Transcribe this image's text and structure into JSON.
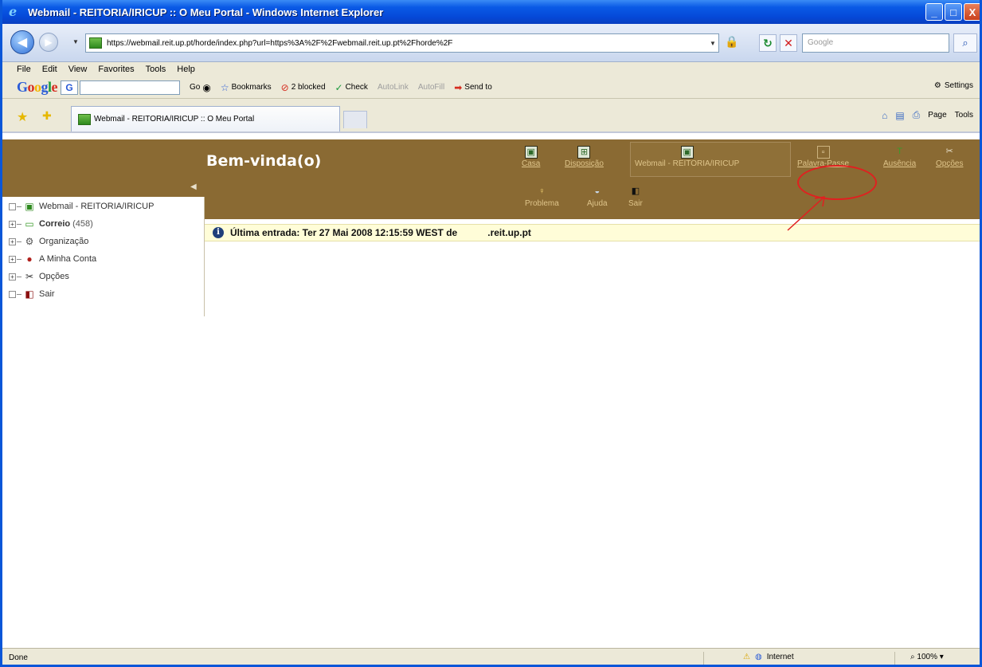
{
  "window": {
    "title": "Webmail - REITORIA/IRICUP :: O Meu Portal - Windows Internet Explorer",
    "buttons": {
      "minimize": "_",
      "maximize": "□",
      "close": "X"
    }
  },
  "address": {
    "url": "https://webmail.reit.up.pt/horde/index.php?url=https%3A%2F%2Fwebmail.reit.up.pt%2Fhorde%2F",
    "search_placeholder": "Google"
  },
  "menu": [
    "File",
    "Edit",
    "View",
    "Favorites",
    "Tools",
    "Help"
  ],
  "google_toolbar": {
    "go": "Go",
    "bookmarks": "Bookmarks",
    "blocked": "2 blocked",
    "check": "Check",
    "autolink": "AutoLink",
    "autofill": "AutoFill",
    "send_to": "Send to",
    "settings": "Settings"
  },
  "tabs": {
    "active_label": "Webmail - REITORIA/IRICUP :: O Meu Portal",
    "page_tool": "Page",
    "tools_tool": "Tools"
  },
  "portal": {
    "welcome": "Bem-vinda(o)",
    "nav": {
      "casa": "Casa",
      "disposicao": "Disposição",
      "webmail": "Webmail - REITORIA/IRICUP",
      "palavra_passe": "Palavra-Passe",
      "ausencia": "Ausência",
      "opcoes": "Opções",
      "problema": "Problema",
      "ajuda": "Ajuda",
      "sair": "Sair"
    },
    "sidebar": {
      "webmail": "Webmail - REITORIA/IRICUP",
      "correio": "Correio",
      "correio_count": "(458)",
      "organizacao": "Organização",
      "minha_conta": "A Minha Conta",
      "opcoes": "Opções",
      "sair": "Sair"
    },
    "last_login": "Última entrada: Ter 27 Mai 2008 12:15:59 WEST de",
    "last_login_host": ".reit.up.pt"
  },
  "status": {
    "left": "Done",
    "zone": "Internet",
    "zoom": "100%"
  },
  "colors": {
    "portal_brown": "#8a6a33",
    "nav_text": "#dec48a",
    "annotation_red": "#e02020",
    "login_bar_bg": "#fffdd8"
  }
}
